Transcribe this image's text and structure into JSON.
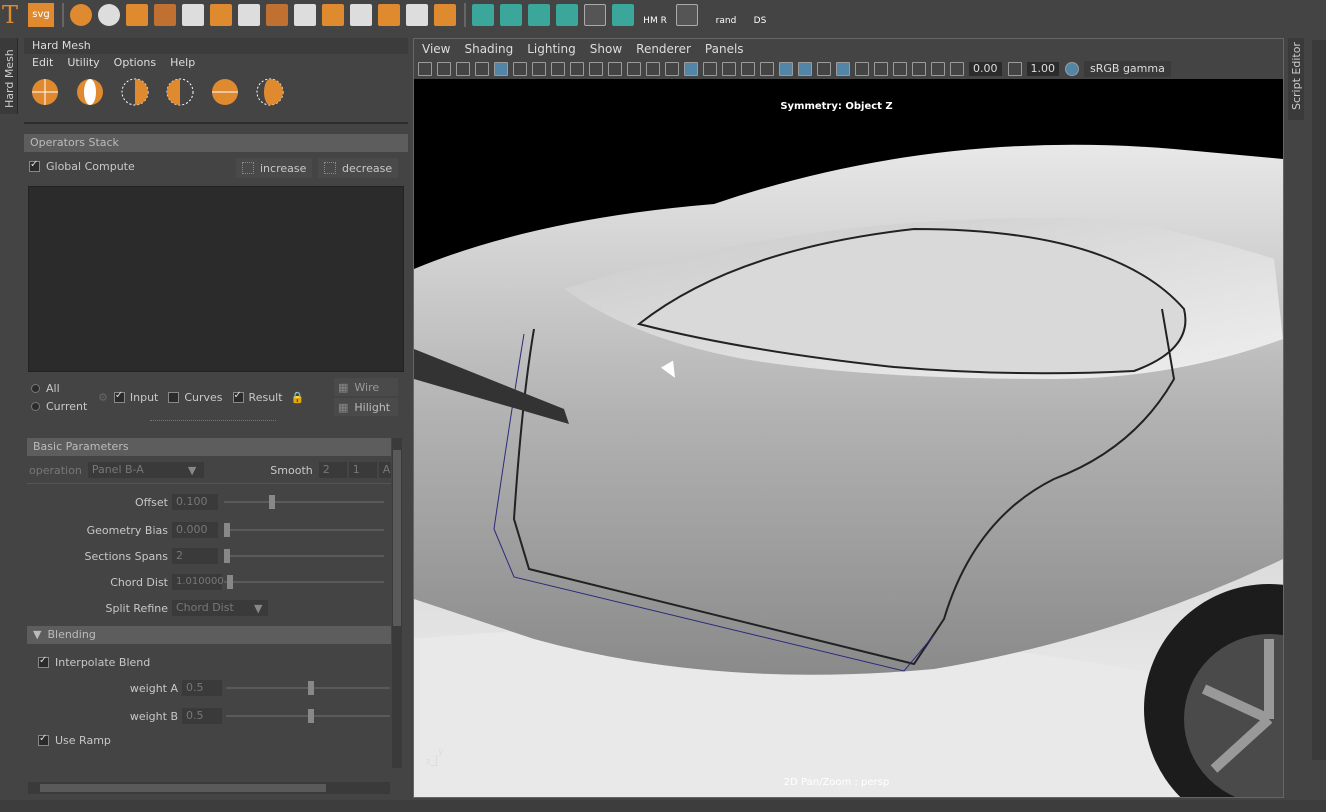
{
  "shelf": {
    "items": [
      {
        "label": "T",
        "color": "#e08a30"
      },
      {
        "label": "svg",
        "color": "#e08a30"
      },
      {
        "label": "HM R"
      },
      {
        "label": "rand"
      },
      {
        "label": "DS"
      }
    ]
  },
  "side_tab": {
    "label": "Hard Mesh"
  },
  "panel": {
    "title": "Hard Mesh",
    "menu": [
      "Edit",
      "Utility",
      "Options",
      "Help"
    ],
    "operators_stack": {
      "title": "Operators Stack",
      "global_compute": "Global Compute",
      "increase": "increase",
      "decrease": "decrease"
    },
    "filters": {
      "all": "All",
      "current": "Current",
      "input": "Input",
      "curves": "Curves",
      "result": "Result",
      "wire": "Wire",
      "hilight": "Hilight"
    },
    "basic_parameters": {
      "title": "Basic Parameters",
      "operation_label": "operation",
      "operation_value": "Panel B-A",
      "smooth_label": "Smooth",
      "smooth_a": "2",
      "smooth_b": "1",
      "smooth_c": "A",
      "offset_label": "Offset",
      "offset_value": "0.100",
      "offset_level": 0.28,
      "geometry_bias_label": "Geometry Bias",
      "geometry_bias_value": "0.000",
      "geometry_bias_level": 0.0,
      "sections_spans_label": "Sections Spans",
      "sections_spans_value": "2",
      "sections_spans_level": 0.0,
      "chord_dist_label": "Chord Dist",
      "chord_dist_value": "1.010000",
      "chord_dist_level": 0.02,
      "split_refine_label": "Split Refine",
      "split_refine_value": "Chord Dist"
    },
    "blending": {
      "title": "Blending",
      "interpolate_blend": "Interpolate Blend",
      "weight_a_label": "weight A",
      "weight_a_value": "0.5",
      "weight_a_level": 0.5,
      "weight_b_label": "weight B",
      "weight_b_value": "0.5",
      "weight_b_level": 0.5,
      "use_ramp": "Use Ramp"
    }
  },
  "viewport": {
    "menu": [
      "View",
      "Shading",
      "Lighting",
      "Show",
      "Renderer",
      "Panels"
    ],
    "exposure": "0.00",
    "gamma": "1.00",
    "color_space": "sRGB gamma",
    "symmetry_text": "Symmetry: Object Z",
    "bottom_text": "2D Pan/Zoom : persp",
    "axis_y": "y",
    "axis_z": "z"
  },
  "right_tab": {
    "label": "Script Editor"
  },
  "colors": {
    "accent": "#e08a30",
    "viewport_bg": "#000000",
    "panel_bg": "#444444"
  }
}
